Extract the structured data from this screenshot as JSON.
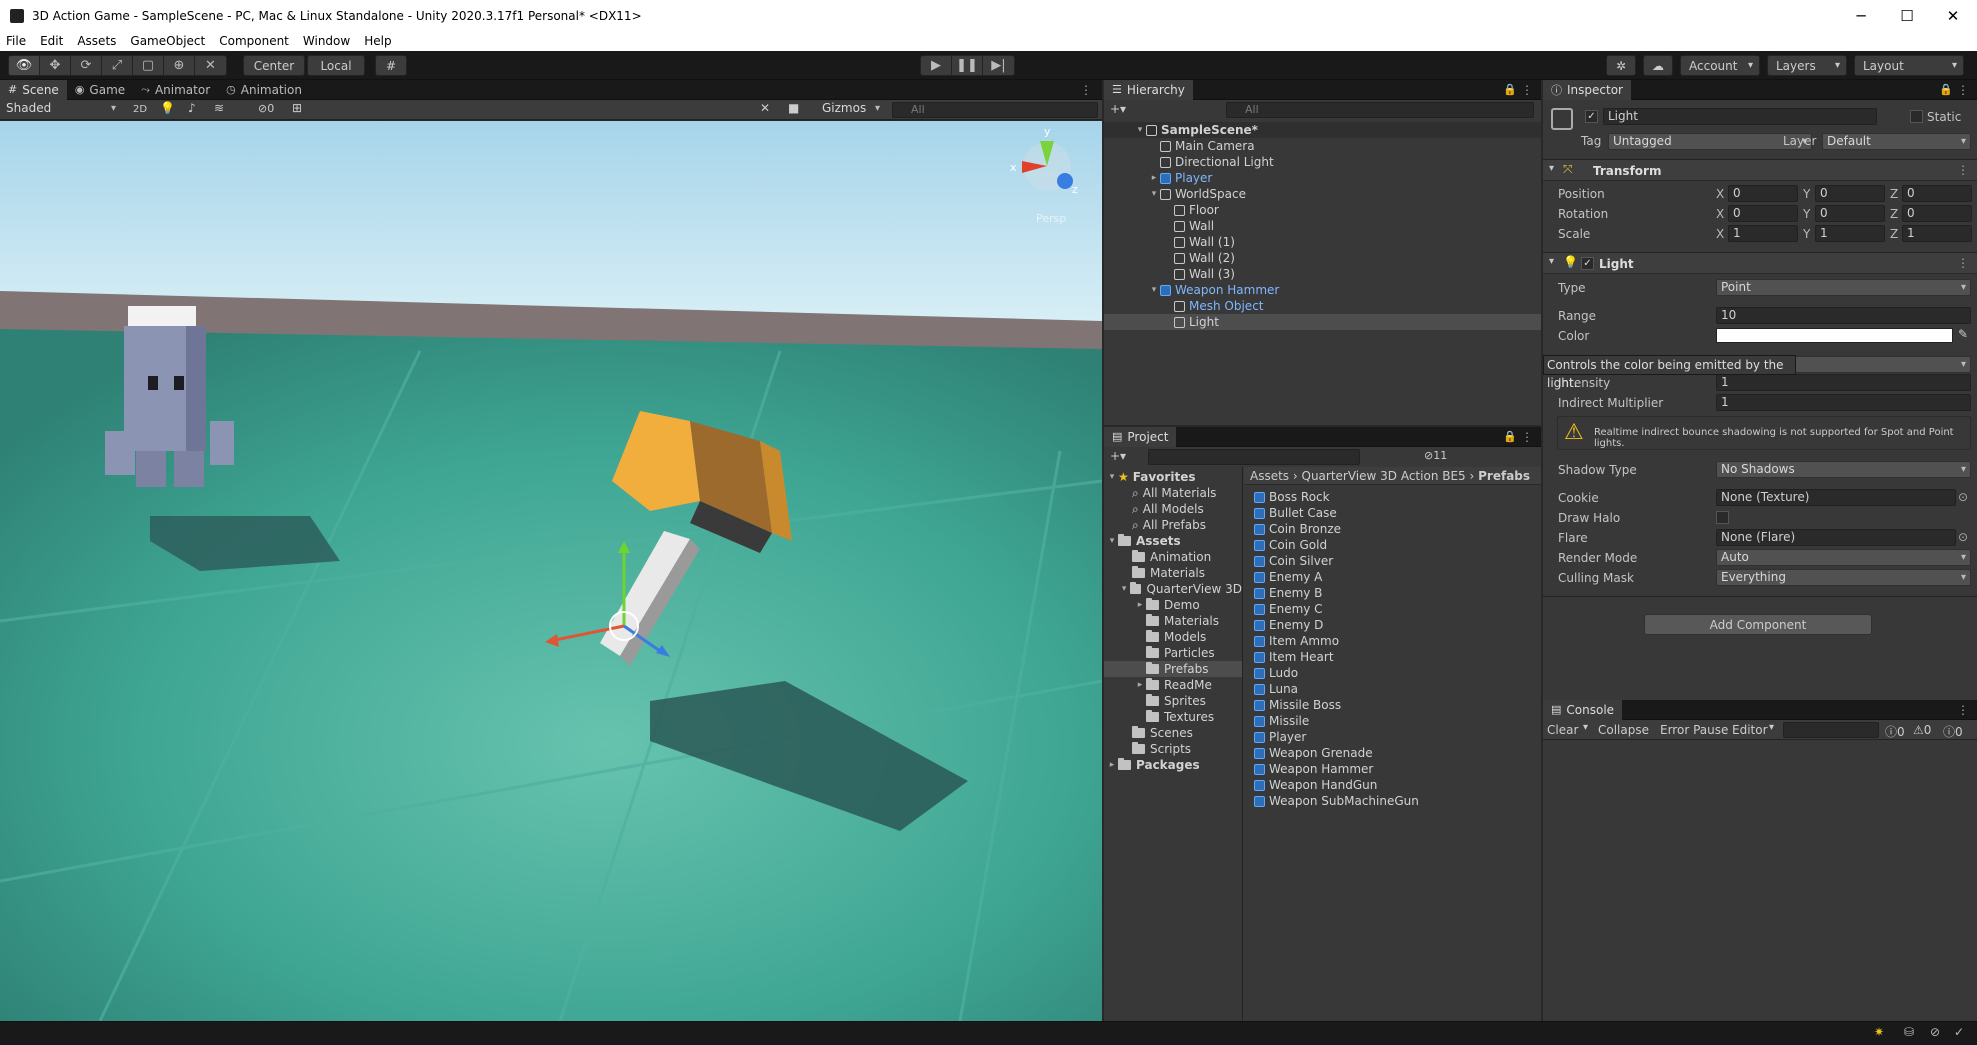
{
  "window": {
    "title": "3D Action Game - SampleScene - PC, Mac & Linux Standalone - Unity 2020.3.17f1 Personal* <DX11>",
    "minimize": "─",
    "maximize": "☐",
    "close": "✕"
  },
  "menu": [
    "File",
    "Edit",
    "Assets",
    "GameObject",
    "Component",
    "Window",
    "Help"
  ],
  "toolbar": {
    "pivot_center": "Center",
    "pivot_local": "Local",
    "account": "Account",
    "layers": "Layers",
    "layout": "Layout"
  },
  "scene_panel": {
    "tabs": [
      "Scene",
      "Game",
      "Animator",
      "Animation"
    ],
    "shading": "Shaded",
    "mode_2d": "2D",
    "hidden_count": "0",
    "gizmos": "Gizmos",
    "search_placeholder": "All",
    "gizmo_axes": {
      "y": "y",
      "x": "x",
      "z": "z"
    },
    "persp": "Persp"
  },
  "hierarchy": {
    "tab": "Hierarchy",
    "search_placeholder": "All",
    "items": [
      {
        "label": "SampleScene*",
        "depth": 0,
        "type": "scene",
        "arrow": "▾"
      },
      {
        "label": "Main Camera",
        "depth": 1,
        "type": "object",
        "arrow": ""
      },
      {
        "label": "Directional Light",
        "depth": 1,
        "type": "object",
        "arrow": ""
      },
      {
        "label": "Player",
        "depth": 1,
        "type": "prefab",
        "arrow": "▸"
      },
      {
        "label": "WorldSpace",
        "depth": 1,
        "type": "object",
        "arrow": "▾"
      },
      {
        "label": "Floor",
        "depth": 2,
        "type": "object",
        "arrow": ""
      },
      {
        "label": "Wall",
        "depth": 2,
        "type": "object",
        "arrow": ""
      },
      {
        "label": "Wall (1)",
        "depth": 2,
        "type": "object",
        "arrow": ""
      },
      {
        "label": "Wall (2)",
        "depth": 2,
        "type": "object",
        "arrow": ""
      },
      {
        "label": "Wall (3)",
        "depth": 2,
        "type": "object",
        "arrow": ""
      },
      {
        "label": "Weapon Hammer",
        "depth": 1,
        "type": "prefab",
        "arrow": "▾"
      },
      {
        "label": "Mesh Object",
        "depth": 2,
        "type": "prefab-child",
        "arrow": ""
      },
      {
        "label": "Light",
        "depth": 2,
        "type": "object",
        "arrow": "",
        "selected": true
      }
    ]
  },
  "project": {
    "tab": "Project",
    "hidden_count": "11",
    "breadcrumb": [
      "Assets",
      "QuarterView 3D Action BE5",
      "Prefabs"
    ],
    "tree": [
      {
        "label": "Favorites",
        "depth": 0,
        "arrow": "▾",
        "kind": "star"
      },
      {
        "label": "All Materials",
        "depth": 1,
        "arrow": "",
        "kind": "search"
      },
      {
        "label": "All Models",
        "depth": 1,
        "arrow": "",
        "kind": "search"
      },
      {
        "label": "All Prefabs",
        "depth": 1,
        "arrow": "",
        "kind": "search"
      },
      {
        "label": "Assets",
        "depth": 0,
        "arrow": "▾",
        "kind": "folder"
      },
      {
        "label": "Animation",
        "depth": 1,
        "arrow": "",
        "kind": "folder"
      },
      {
        "label": "Materials",
        "depth": 1,
        "arrow": "",
        "kind": "folder"
      },
      {
        "label": "QuarterView 3D",
        "depth": 1,
        "arrow": "▾",
        "kind": "folder"
      },
      {
        "label": "Demo",
        "depth": 2,
        "arrow": "▸",
        "kind": "folder"
      },
      {
        "label": "Materials",
        "depth": 2,
        "arrow": "",
        "kind": "folder"
      },
      {
        "label": "Models",
        "depth": 2,
        "arrow": "",
        "kind": "folder"
      },
      {
        "label": "Particles",
        "depth": 2,
        "arrow": "",
        "kind": "folder"
      },
      {
        "label": "Prefabs",
        "depth": 2,
        "arrow": "",
        "kind": "folder",
        "selected": true
      },
      {
        "label": "ReadMe",
        "depth": 2,
        "arrow": "▸",
        "kind": "folder"
      },
      {
        "label": "Sprites",
        "depth": 2,
        "arrow": "",
        "kind": "folder"
      },
      {
        "label": "Textures",
        "depth": 2,
        "arrow": "",
        "kind": "folder"
      },
      {
        "label": "Scenes",
        "depth": 1,
        "arrow": "",
        "kind": "folder"
      },
      {
        "label": "Scripts",
        "depth": 1,
        "arrow": "",
        "kind": "folder"
      },
      {
        "label": "Packages",
        "depth": 0,
        "arrow": "▸",
        "kind": "folder"
      }
    ],
    "prefabs": [
      "Boss Rock",
      "Bullet Case",
      "Coin Bronze",
      "Coin Gold",
      "Coin Silver",
      "Enemy A",
      "Enemy B",
      "Enemy C",
      "Enemy D",
      "Item Ammo",
      "Item Heart",
      "Ludo",
      "Luna",
      "Missile Boss",
      "Missile",
      "Player",
      "Weapon Grenade",
      "Weapon Hammer",
      "Weapon HandGun",
      "Weapon SubMachineGun"
    ]
  },
  "inspector": {
    "tab": "Inspector",
    "object_name": "Light",
    "static_label": "Static",
    "tag_label": "Tag",
    "tag_value": "Untagged",
    "layer_label": "Layer",
    "layer_value": "Default",
    "transform": {
      "title": "Transform",
      "rows": [
        {
          "label": "Position",
          "x": "0",
          "y": "0",
          "z": "0"
        },
        {
          "label": "Rotation",
          "x": "0",
          "y": "0",
          "z": "0"
        },
        {
          "label": "Scale",
          "x": "1",
          "y": "1",
          "z": "1"
        }
      ]
    },
    "light": {
      "title": "Light",
      "type_label": "Type",
      "type_value": "Point",
      "range_label": "Range",
      "range_value": "10",
      "color_label": "Color",
      "color_value": "#ffffff",
      "tooltip": "Controls the color being emitted by the light.",
      "intensity_label": "Intensity",
      "intensity_value": "1",
      "indirect_label": "Indirect Multiplier",
      "indirect_value": "1",
      "warning": "Realtime indirect bounce shadowing is not supported for Spot and Point lights.",
      "shadow_label": "Shadow Type",
      "shadow_value": "No Shadows",
      "cookie_label": "Cookie",
      "cookie_value": "None (Texture)",
      "halo_label": "Draw Halo",
      "flare_label": "Flare",
      "flare_value": "None (Flare)",
      "render_label": "Render Mode",
      "render_value": "Auto",
      "culling_label": "Culling Mask",
      "culling_value": "Everything"
    },
    "add_component": "Add Component"
  },
  "console": {
    "tab": "Console",
    "clear": "Clear",
    "collapse": "Collapse",
    "error_pause": "Error Pause",
    "editor": "Editor",
    "log_count": "0",
    "warn_count": "0",
    "error_count": "0"
  },
  "colors": {
    "accent": "#2c5d87",
    "selected_row": "#4d4d4d",
    "prefab_text": "#7fb7ff"
  }
}
